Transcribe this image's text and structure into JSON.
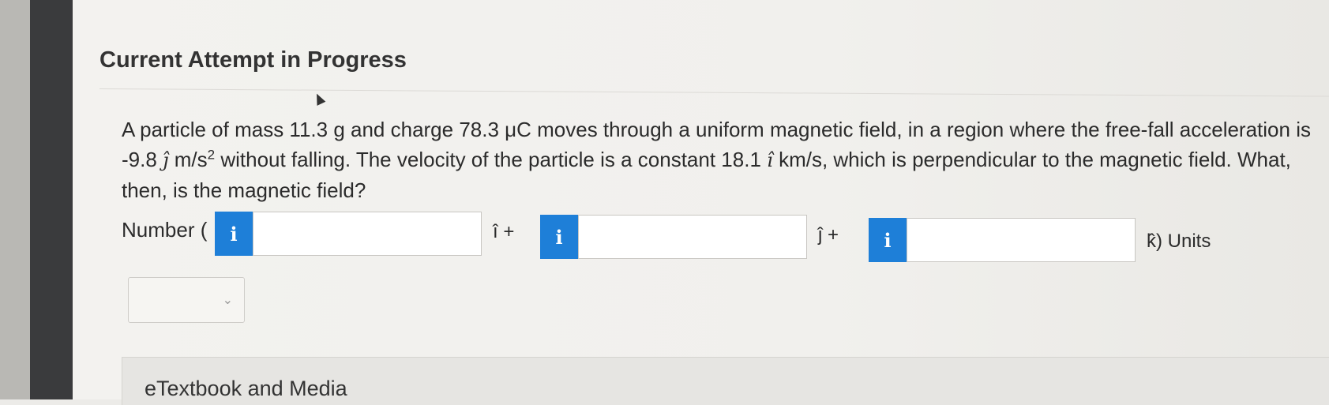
{
  "page": {
    "title": "Current Attempt in Progress"
  },
  "question": {
    "part1": "A particle of mass 11.3 g and charge 78.3 μC moves through a uniform magnetic field, in a region where the free-fall acceleration is -9.8",
    "j_hat": "ĵ",
    "part2": "m/s",
    "exponent": "2",
    "part3": "without falling. The velocity of the particle is a constant 18.1",
    "i_hat": "î",
    "part4": "km/s, which is perpendicular to the magnetic field. What, then, is the magnetic field?"
  },
  "answer": {
    "number_label": "Number (",
    "info_glyph": "i",
    "i_component": {
      "value": "",
      "unit_label": "î +"
    },
    "j_component": {
      "value": "",
      "unit_label": "ĵ +"
    },
    "k_component": {
      "value": "",
      "unit_label": "k̂) Units"
    },
    "units_selected": "",
    "chevron": "⌄"
  },
  "etextbook": {
    "label": "eTextbook and Media"
  },
  "colors": {
    "info_button": "#1e7fd8",
    "left_bar": "#3a3b3d"
  }
}
